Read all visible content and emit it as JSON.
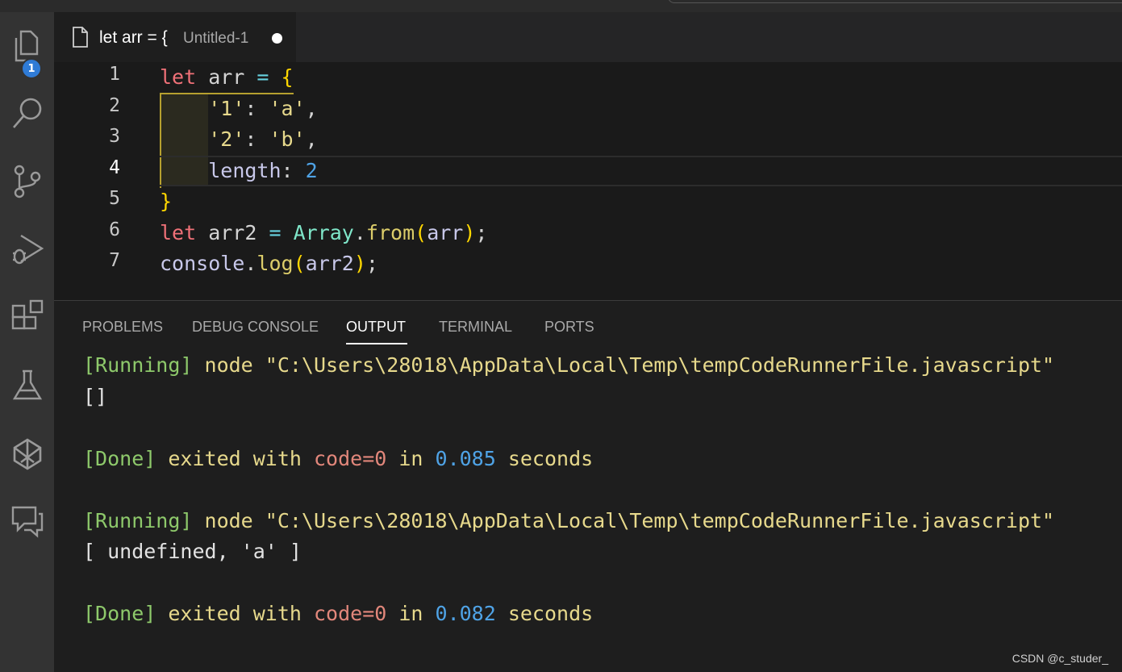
{
  "activity_bar": {
    "explorer_badge": "1",
    "items": [
      "explorer-icon",
      "search-icon",
      "source-control-icon",
      "run-debug-icon",
      "extensions-icon",
      "testing-icon",
      "remote-icon",
      "chat-icon"
    ]
  },
  "tab": {
    "title": "let arr = {",
    "description": "Untitled-1"
  },
  "editor": {
    "line_numbers": [
      "1",
      "2",
      "3",
      "4",
      "5",
      "6",
      "7"
    ],
    "active_line": "4",
    "lines": [
      [
        {
          "t": "let",
          "c": "kw"
        },
        {
          "t": " arr ",
          "c": "var"
        },
        {
          "t": "=",
          "c": "op"
        },
        {
          "t": " ",
          "c": "var"
        },
        {
          "t": "{",
          "c": "br"
        }
      ],
      [
        {
          "t": "    ",
          "c": "var"
        },
        {
          "t": "'1'",
          "c": "str"
        },
        {
          "t": ": ",
          "c": "var"
        },
        {
          "t": "'a'",
          "c": "str"
        },
        {
          "t": ",",
          "c": "var"
        }
      ],
      [
        {
          "t": "    ",
          "c": "var"
        },
        {
          "t": "'2'",
          "c": "str"
        },
        {
          "t": ": ",
          "c": "var"
        },
        {
          "t": "'b'",
          "c": "str"
        },
        {
          "t": ",",
          "c": "var"
        }
      ],
      [
        {
          "t": "    ",
          "c": "var"
        },
        {
          "t": "length",
          "c": "prop"
        },
        {
          "t": ": ",
          "c": "var"
        },
        {
          "t": "2",
          "c": "num"
        }
      ],
      [
        {
          "t": "}",
          "c": "br"
        }
      ],
      [
        {
          "t": "let",
          "c": "kw"
        },
        {
          "t": " arr2 ",
          "c": "var"
        },
        {
          "t": "=",
          "c": "op"
        },
        {
          "t": " ",
          "c": "var"
        },
        {
          "t": "Array",
          "c": "cls"
        },
        {
          "t": ".",
          "c": "var"
        },
        {
          "t": "from",
          "c": "fn"
        },
        {
          "t": "(",
          "c": "br"
        },
        {
          "t": "arr",
          "c": "prop"
        },
        {
          "t": ")",
          "c": "br"
        },
        {
          "t": ";",
          "c": "var"
        }
      ],
      [
        {
          "t": "console",
          "c": "prop"
        },
        {
          "t": ".",
          "c": "var"
        },
        {
          "t": "log",
          "c": "fn"
        },
        {
          "t": "(",
          "c": "br"
        },
        {
          "t": "arr2",
          "c": "prop"
        },
        {
          "t": ")",
          "c": "br"
        },
        {
          "t": ";",
          "c": "var"
        }
      ]
    ]
  },
  "panel": {
    "tabs": [
      "PROBLEMS",
      "DEBUG CONSOLE",
      "OUTPUT",
      "TERMINAL",
      "PORTS"
    ],
    "active_tab": "OUTPUT",
    "output": [
      [
        {
          "t": "[Running]",
          "c": "green"
        },
        {
          "t": " node \"C:\\Users\\28018\\AppData\\Local\\Temp\\tempCodeRunnerFile.javascript\"",
          "c": "yellow"
        }
      ],
      [
        {
          "t": "[]",
          "c": "plain"
        }
      ],
      [],
      [
        {
          "t": "[Done]",
          "c": "green"
        },
        {
          "t": " exited with ",
          "c": "yellow"
        },
        {
          "t": "code=0",
          "c": "red"
        },
        {
          "t": " in ",
          "c": "yellow"
        },
        {
          "t": "0.085",
          "c": "blue"
        },
        {
          "t": " seconds",
          "c": "yellow"
        }
      ],
      [],
      [
        {
          "t": "[Running]",
          "c": "green"
        },
        {
          "t": " node \"C:\\Users\\28018\\AppData\\Local\\Temp\\tempCodeRunnerFile.javascript\"",
          "c": "yellow"
        }
      ],
      [
        {
          "t": "[ undefined, 'a' ]",
          "c": "plain"
        }
      ],
      [],
      [
        {
          "t": "[Done]",
          "c": "green"
        },
        {
          "t": " exited with ",
          "c": "yellow"
        },
        {
          "t": "code=0",
          "c": "red"
        },
        {
          "t": " in ",
          "c": "yellow"
        },
        {
          "t": "0.082",
          "c": "blue"
        },
        {
          "t": " seconds",
          "c": "yellow"
        }
      ]
    ]
  },
  "watermark": "CSDN @c_studer_"
}
